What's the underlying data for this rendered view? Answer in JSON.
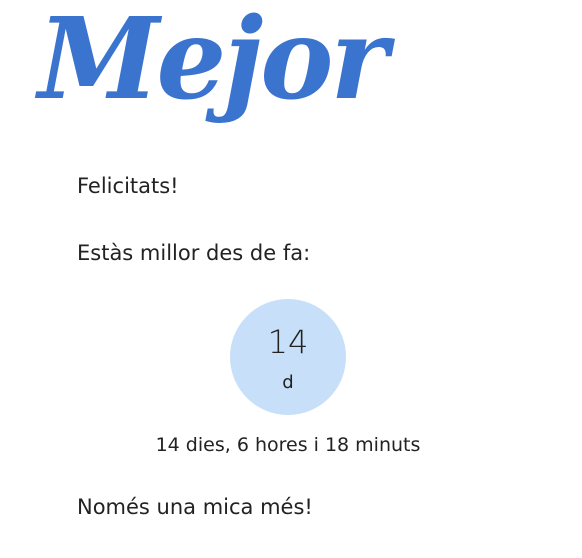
{
  "brand": {
    "logo_text": "Mejor",
    "color": "#3a74cf"
  },
  "message": {
    "congrats": "Felicitats!",
    "since": "Estàs millor des de fa:",
    "more": "Només una mica més!"
  },
  "counter": {
    "value": "14",
    "unit": "d",
    "background": "#c7dff8"
  },
  "duration_text": "14 dies, 6 hores i 18 minuts"
}
